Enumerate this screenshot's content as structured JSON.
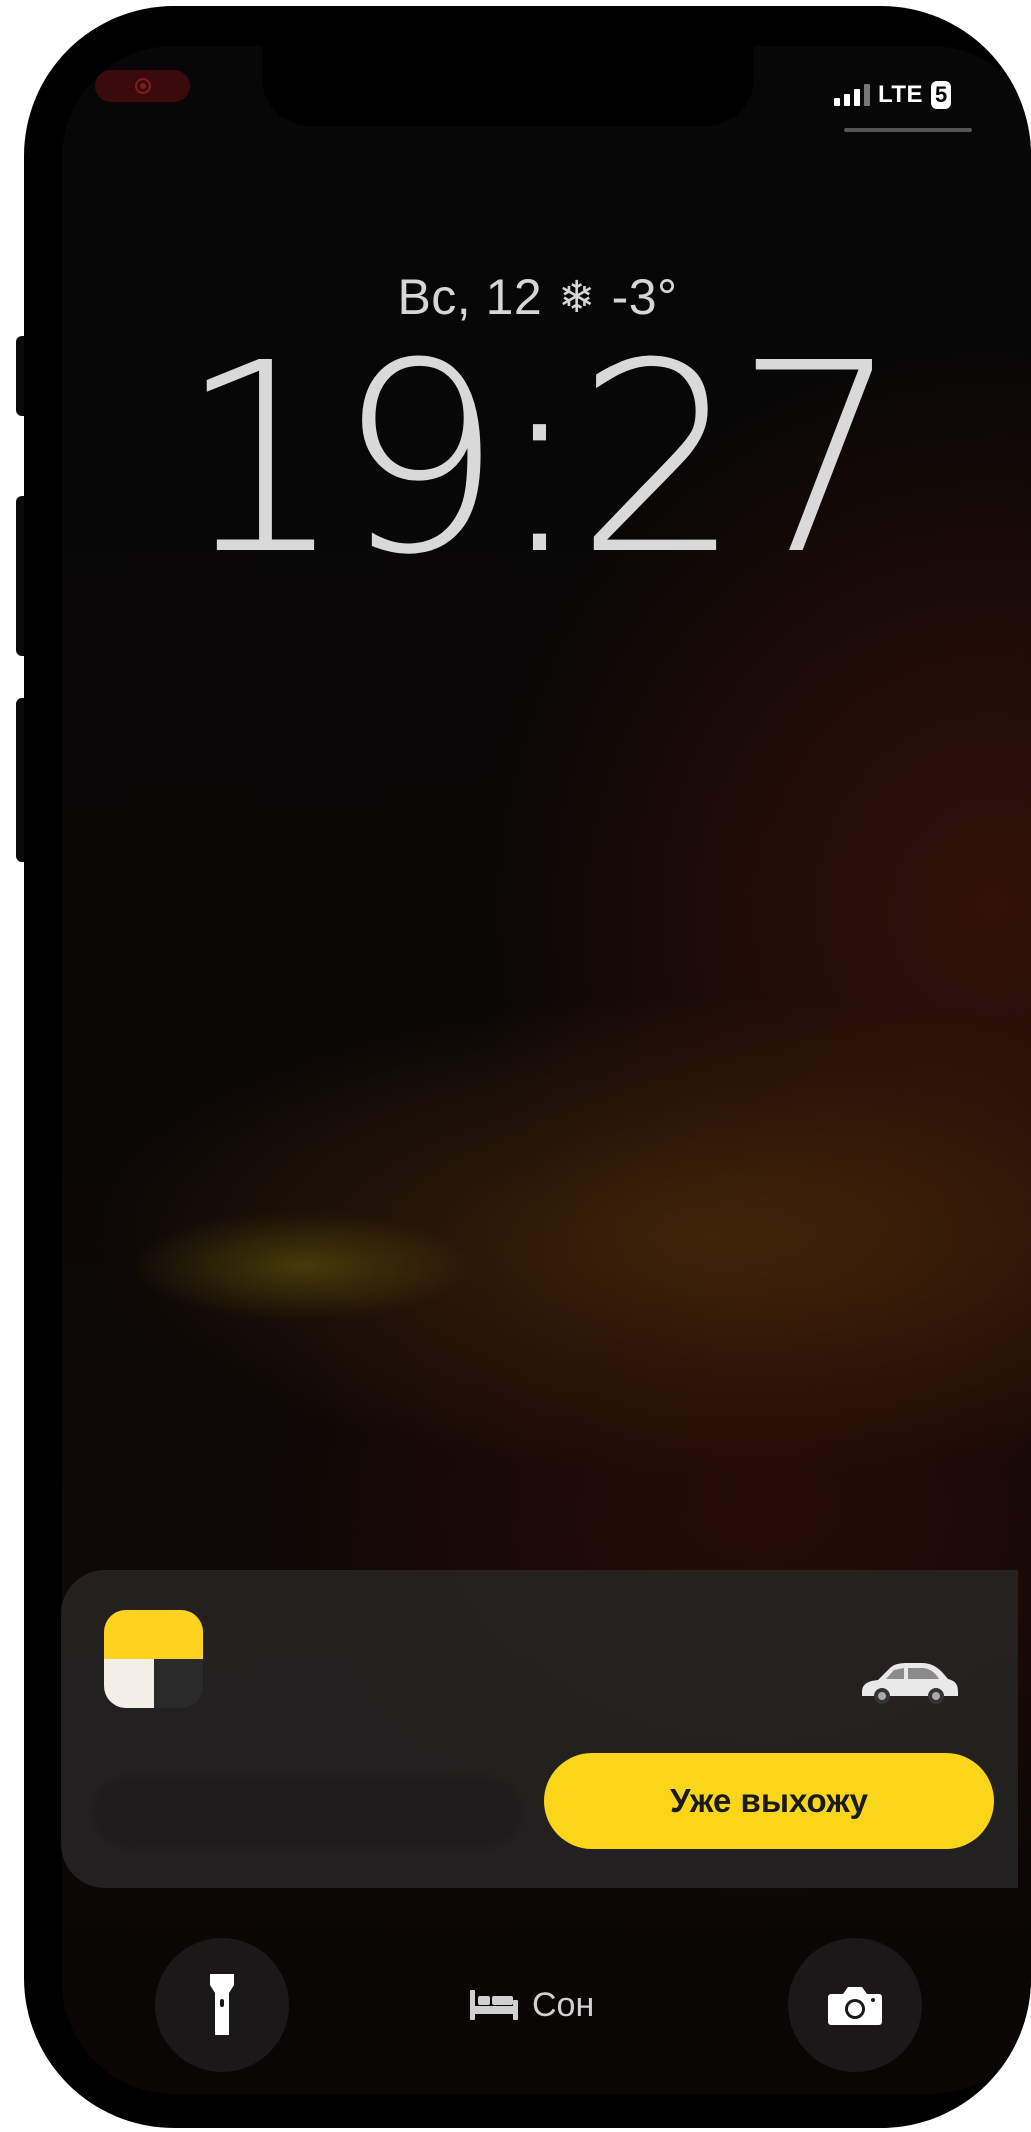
{
  "status_bar": {
    "network": "LTE",
    "battery": "5"
  },
  "lock_screen": {
    "date": "Вс, 12",
    "weather_icon": "snowflake-icon",
    "temperature": "-3°",
    "time": "19:27"
  },
  "live_activity": {
    "app_icon": "yandex-go-icon",
    "vehicle_icon": "car-icon",
    "action_label": "Уже выхожу",
    "action_color": "#fad519"
  },
  "bottom_bar": {
    "left_icon": "flashlight-icon",
    "focus_icon": "bed-icon",
    "focus_label": "Сон",
    "right_icon": "camera-icon"
  }
}
